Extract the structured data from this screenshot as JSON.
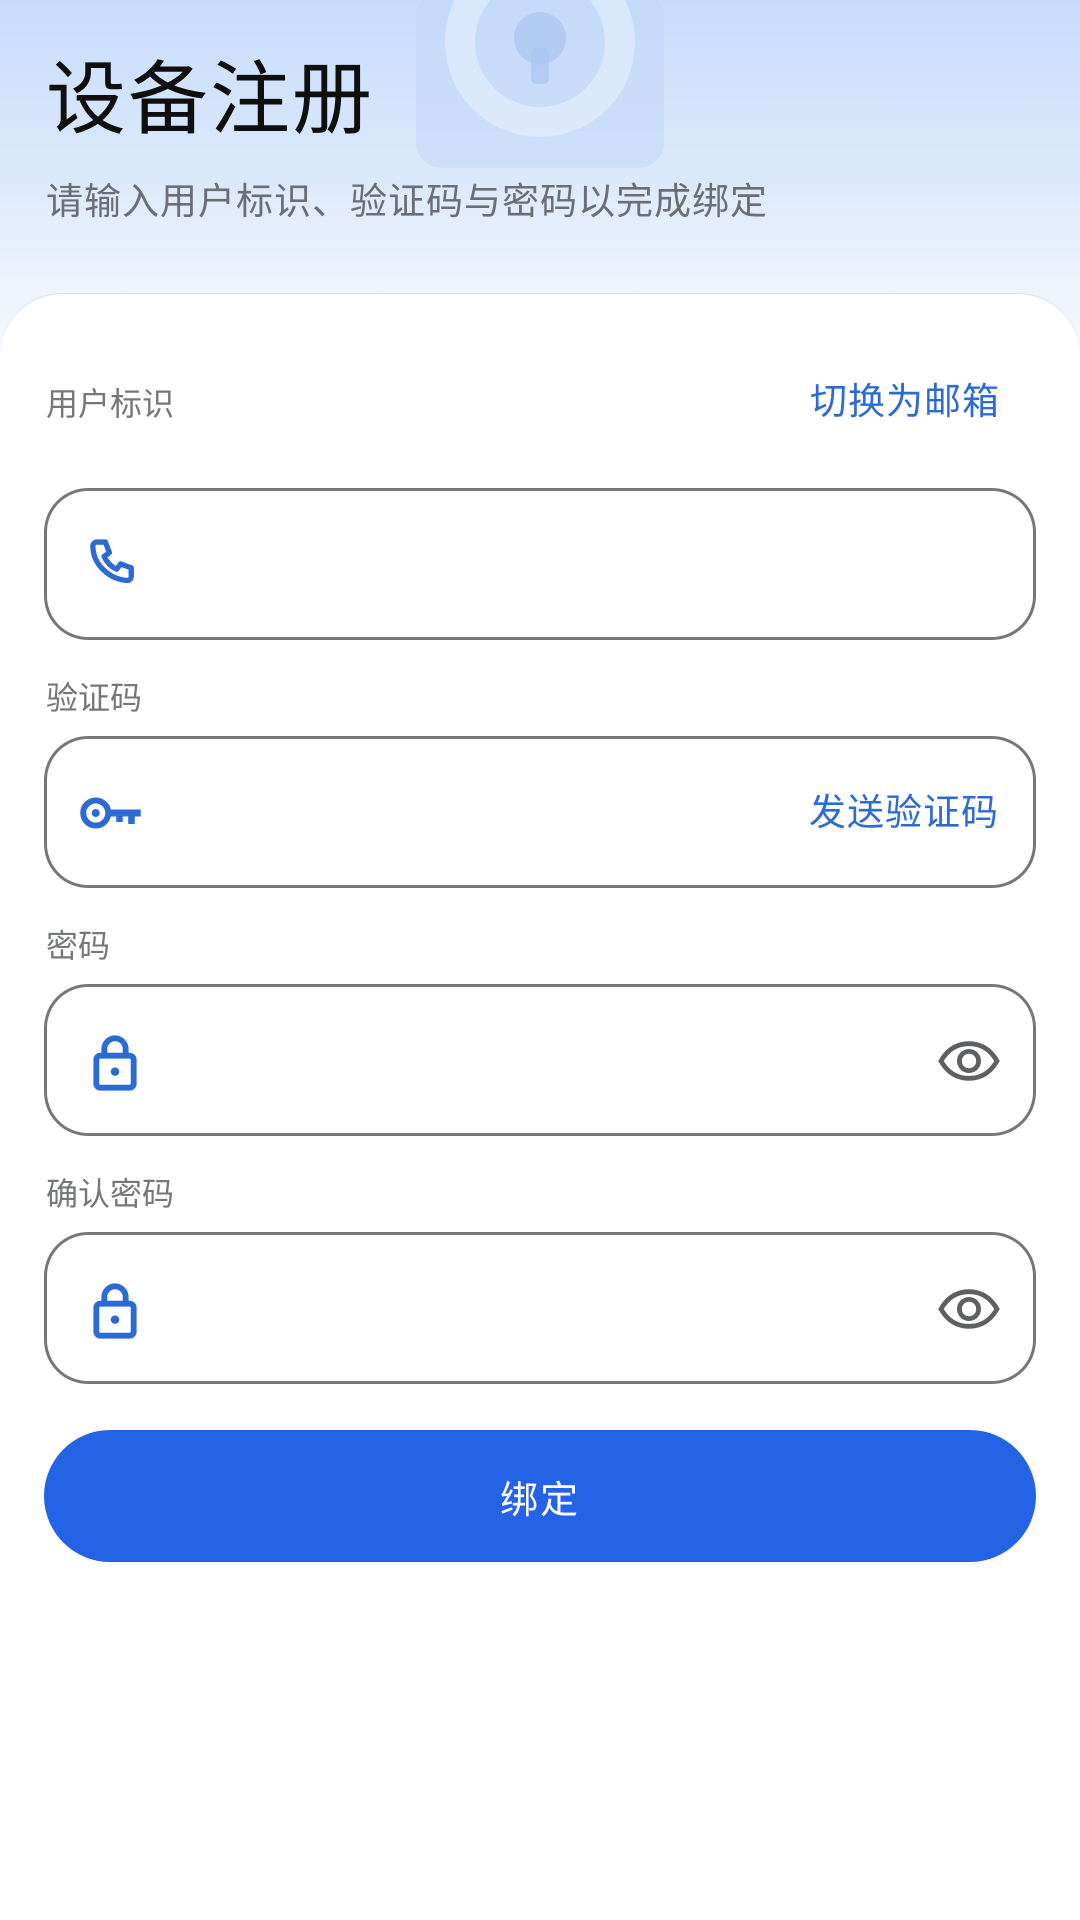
{
  "header": {
    "title": "设备注册",
    "subtitle": "请输入用户标识、验证码与密码以完成绑定"
  },
  "form": {
    "user_id": {
      "label": "用户标识",
      "switch_link": "切换为邮箱",
      "value": "",
      "icon": "phone-icon"
    },
    "verification_code": {
      "label": "验证码",
      "send_link": "发送验证码",
      "value": "",
      "icon": "key-icon"
    },
    "password": {
      "label": "密码",
      "value": "",
      "icon": "lock-icon",
      "toggle_icon": "eye-icon"
    },
    "confirm_password": {
      "label": "确认密码",
      "value": "",
      "icon": "lock-icon",
      "toggle_icon": "eye-icon"
    },
    "submit_label": "绑定"
  },
  "colors": {
    "accent": "#2563e6",
    "link": "#2d6bd4",
    "border": "#76777b",
    "header_gradient_top": "#c7ddfc"
  }
}
